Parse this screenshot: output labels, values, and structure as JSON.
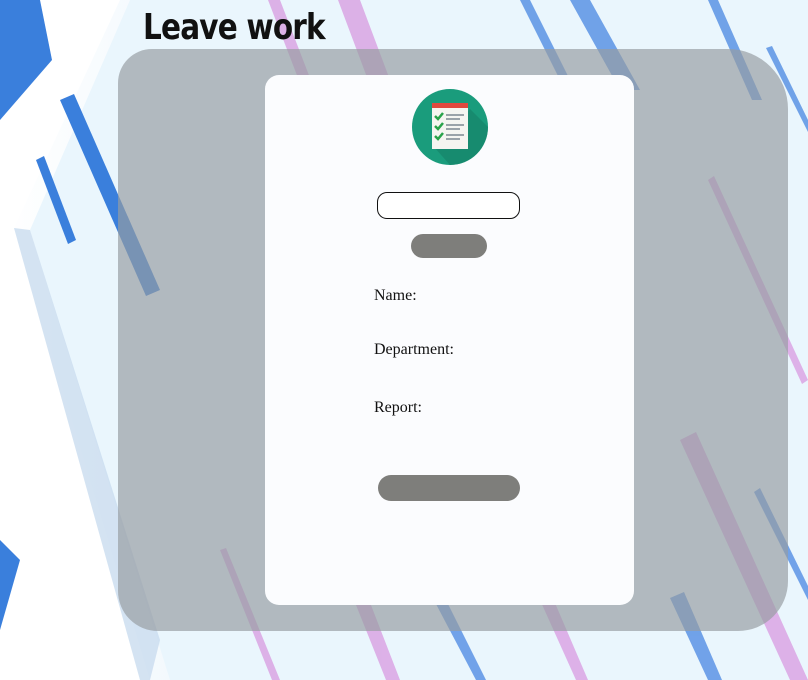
{
  "page": {
    "title": "Leave work"
  },
  "form": {
    "id_input_value": "",
    "search_button_label": "",
    "submit_button_label": "",
    "fields": [
      {
        "label": "Name:",
        "value": ""
      },
      {
        "label": "Department:",
        "value": ""
      },
      {
        "label": "Report:",
        "value": ""
      }
    ]
  },
  "icons": {
    "logo": "checklist-icon"
  },
  "colors": {
    "background": "#eaf6fd",
    "overlay": "#969ca0",
    "card": "#fbfcfe",
    "button": "#7e7e7b",
    "logo_circle": "#1a9c7c",
    "stripe_blue": "#3d7fe0",
    "stripe_purple": "#d89ae0"
  }
}
